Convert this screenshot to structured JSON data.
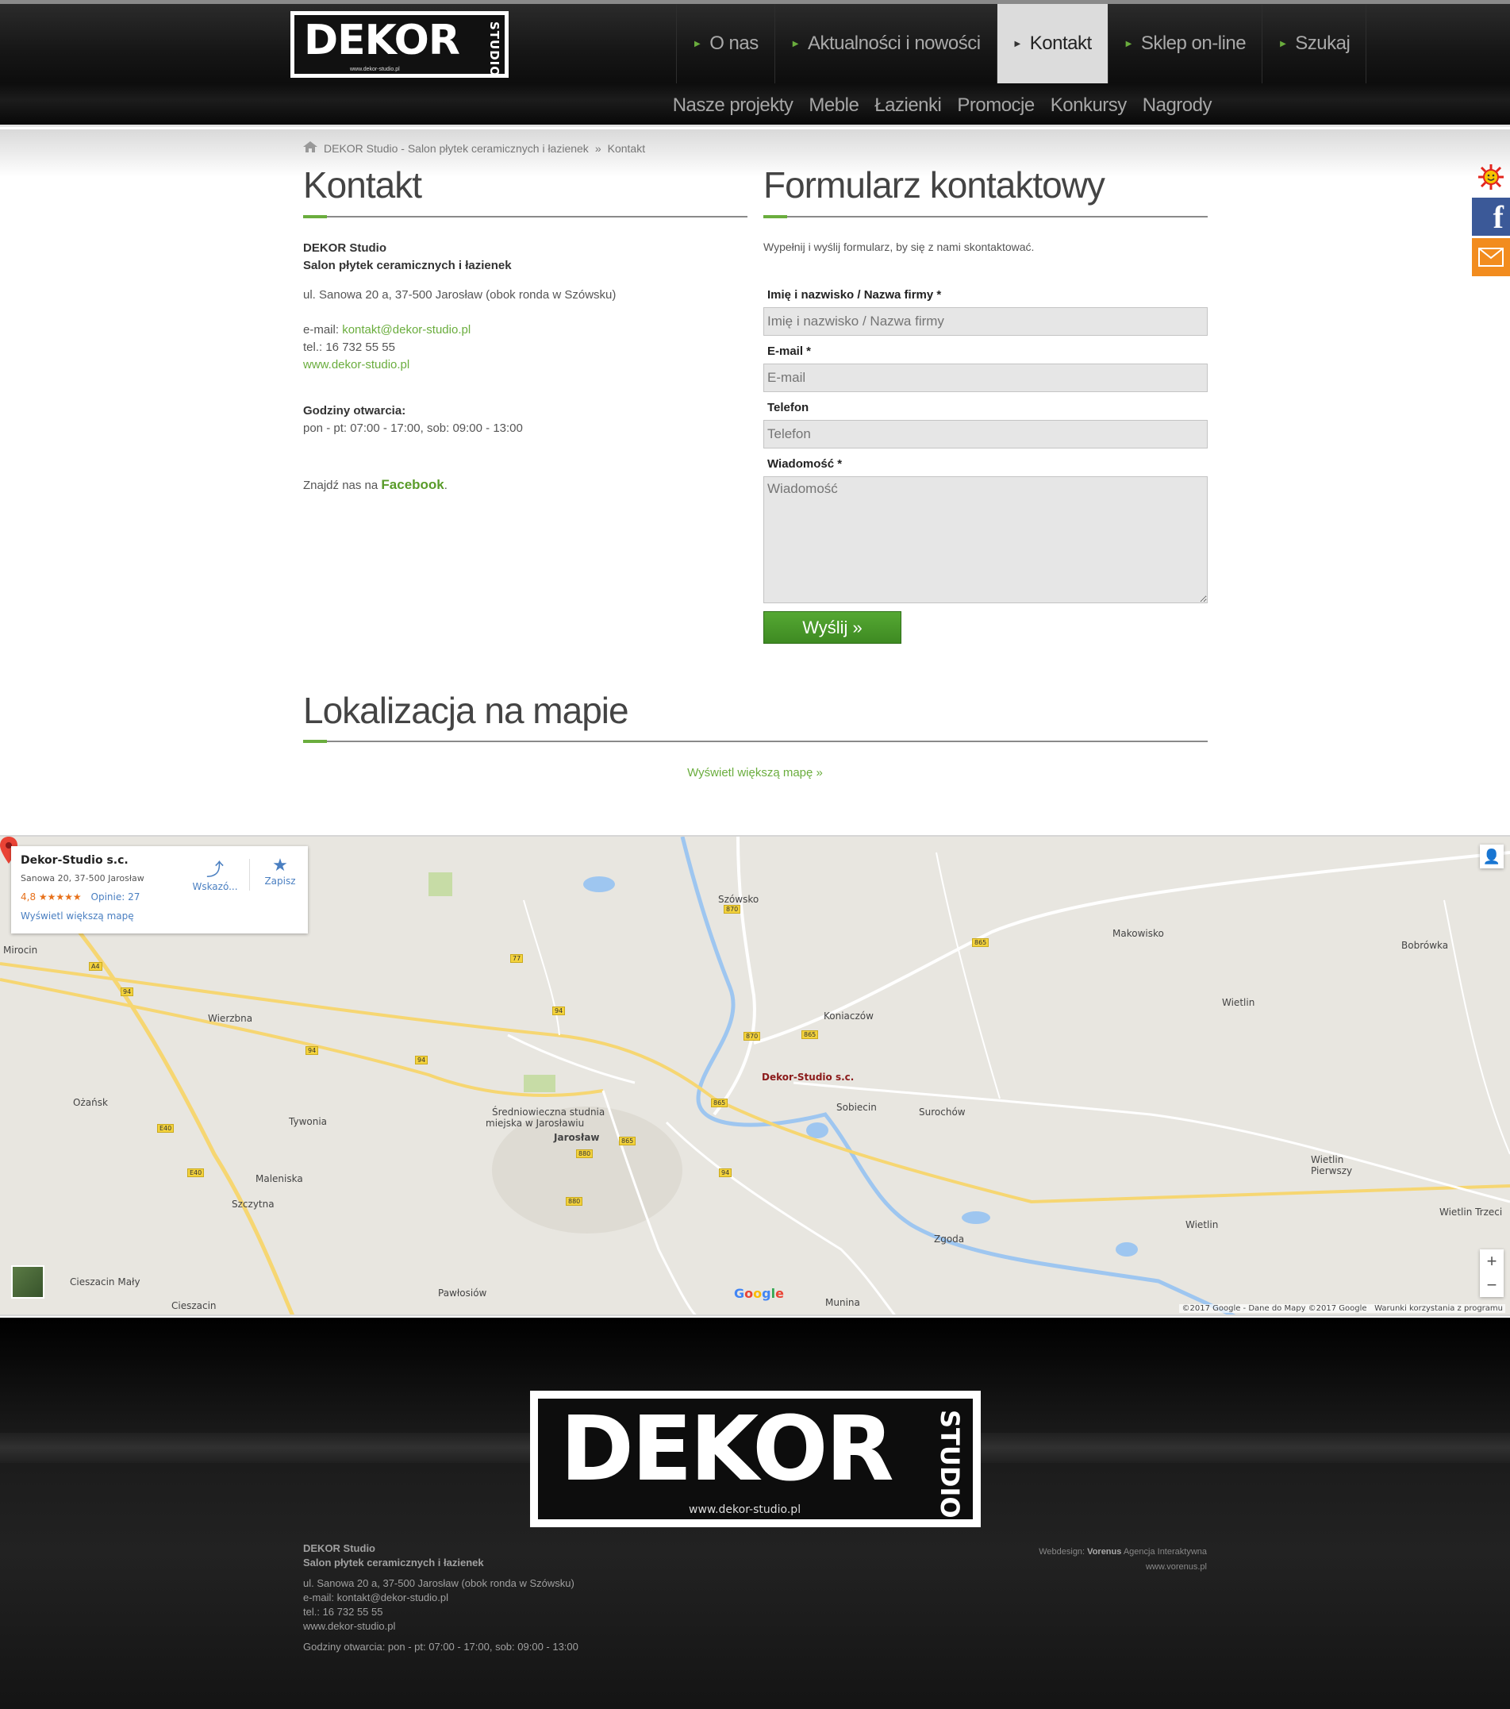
{
  "header": {
    "logo_text": "DEKOR",
    "logo_studio": "STUDIO",
    "logo_url": "www.dekor-studio.pl",
    "main_nav": [
      {
        "label": "O nas",
        "active": false
      },
      {
        "label": "Aktualności i nowości",
        "active": false
      },
      {
        "label": "Kontakt",
        "active": true
      },
      {
        "label": "Sklep on-line",
        "active": false
      },
      {
        "label": "Szukaj",
        "active": false
      }
    ],
    "sub_nav": [
      "Nasze projekty",
      "Meble",
      "Łazienki",
      "Promocje",
      "Konkursy",
      "Nagrody"
    ]
  },
  "breadcrumb": {
    "home": "DEKOR Studio - Salon płytek ceramicznych i łazienek",
    "separator": "»",
    "current": "Kontakt"
  },
  "contact": {
    "heading": "Kontakt",
    "company": "DEKOR Studio",
    "company_sub": "Salon płytek ceramicznych i łazienek",
    "address": "ul. Sanowa 20 a, 37-500 Jarosław (obok ronda w Szówsku)",
    "email_label": "e-mail:",
    "email": "kontakt@dekor-studio.pl",
    "phone": "tel.: 16 732 55 55",
    "website": "www.dekor-studio.pl",
    "hours_label": "Godziny otwarcia:",
    "hours": "pon - pt: 07:00 - 17:00, sob: 09:00 - 13:00",
    "fb_prefix": "Znajdź nas na",
    "fb_link": "Facebook",
    "fb_suffix": "."
  },
  "form": {
    "heading": "Formularz kontaktowy",
    "intro": "Wypełnij i wyślij formularz, by się z nami skontaktować.",
    "fields": [
      {
        "label": "Imię i nazwisko / Nazwa firmy *",
        "placeholder": "Imię i nazwisko / Nazwa firmy"
      },
      {
        "label": "E-mail *",
        "placeholder": "E-mail"
      },
      {
        "label": "Telefon",
        "placeholder": "Telefon"
      },
      {
        "label": "Wiadomość *",
        "placeholder": "Wiadomość"
      }
    ],
    "submit": "Wyślij »"
  },
  "map_section": {
    "heading": "Lokalizacja na mapie",
    "bigger_map_link": "Wyświetl większą mapę »",
    "infocard": {
      "title": "Dekor-Studio s.c.",
      "address": "Sanowa 20, 37-500 Jarosław",
      "rating": "4,8 ★★★★★",
      "reviews": "Opinie: 27",
      "bigger_map": "Wyświetl większą mapę",
      "directions": "Wskazó...",
      "save": "Zapisz"
    },
    "pin_label": "Dekor-Studio s.c.",
    "places": [
      "Szówsko",
      "Makowisko",
      "Bobrówka",
      "Mirocin",
      "Wierzbna",
      "Koniaczów",
      "Wietlin",
      "Ożańsk",
      "Tywonia",
      "Średniowieczna studnia",
      "miejska w Jarosławiu",
      "Jarosław",
      "Sobiecin",
      "Surochów",
      "Maleniska",
      "Wietlin Pierwszy",
      "Szczytna",
      "Wietlin Trzeci",
      "Zgoda",
      "Wietlin",
      "Cieszacin Mały",
      "Pawłosiów",
      "Munina",
      "Cieszacin"
    ],
    "road_badges": [
      "870",
      "77",
      "865",
      "94",
      "A4",
      "94",
      "94",
      "94",
      "870",
      "865",
      "865",
      "880",
      "865",
      "94",
      "880",
      "E40",
      "E40"
    ],
    "google": "Google",
    "copyright": "©2017 Google - Dane do Mapy ©2017 Google",
    "terms": "Warunki korzystania z programu"
  },
  "footer": {
    "company": "DEKOR Studio",
    "company_sub": "Salon płytek ceramicznych i łazienek",
    "address": "ul. Sanowa 20 a, 37-500 Jarosław (obok ronda w Szówsku)",
    "email": "e-mail: kontakt@dekor-studio.pl",
    "phone": "tel.: 16 732 55 55",
    "website": "www.dekor-studio.pl",
    "hours": "Godziny otwarcia: pon - pt: 07:00 - 17:00, sob: 09:00 - 13:00",
    "webdesign_prefix": "Webdesign:",
    "webdesign_name": "Vorenus",
    "webdesign_suffix": "Agencja Interaktywna",
    "webdesign_url": "www.vorenus.pl"
  },
  "colors": {
    "accent_green": "#6aad3d",
    "facebook_blue": "#3b5998",
    "mail_orange": "#f28c1e"
  }
}
